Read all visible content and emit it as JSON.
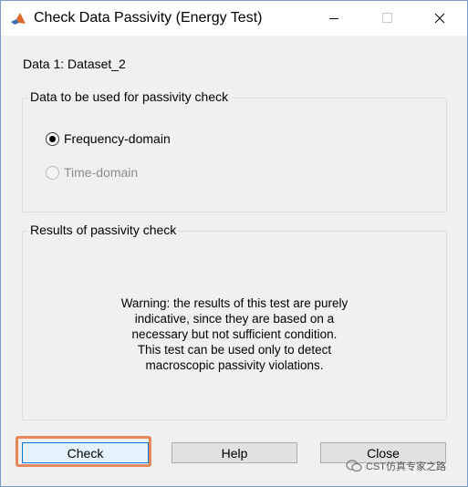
{
  "window": {
    "title": "Check Data Passivity (Energy Test)",
    "icons": [
      "matlab-icon",
      "minimize-icon",
      "maximize-icon",
      "close-icon"
    ]
  },
  "data_label": "Data 1: Dataset_2",
  "data_group": {
    "legend": "Data to be used for passivity check",
    "options": [
      {
        "label": "Frequency-domain",
        "selected": true,
        "enabled": true
      },
      {
        "label": "Time-domain",
        "selected": false,
        "enabled": false
      }
    ]
  },
  "results_group": {
    "legend": "Results of passivity check",
    "warning": "Warning: the results of this test are purely\nindicative, since they are based on a\nnecessary but not sufficient condition.\nThis test can be used only to detect\nmacroscopic passivity violations."
  },
  "buttons": {
    "check": "Check",
    "help": "Help",
    "close": "Close"
  },
  "watermark": "CST仿真专家之路",
  "colors": {
    "highlight": "#e8885a",
    "focus_border": "#0078d7",
    "dialog_bg": "#f0f0f0"
  }
}
